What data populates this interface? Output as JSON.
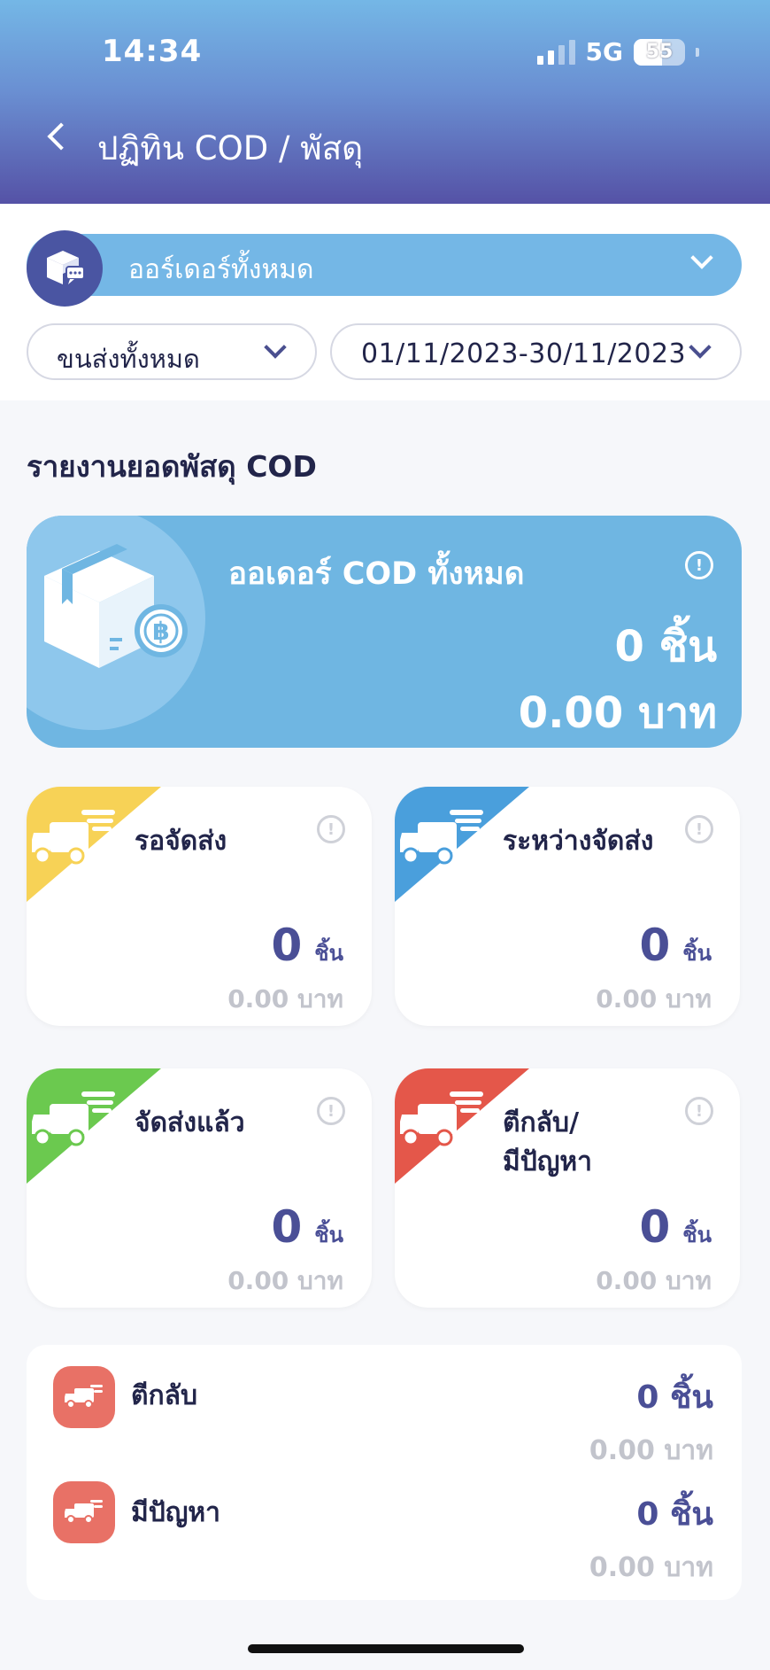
{
  "status_bar": {
    "time": "14:34",
    "network": "5G",
    "battery": "55"
  },
  "header": {
    "title": "ปฏิทิน COD / พัสดุ"
  },
  "filters": {
    "order_select": "ออร์เดอร์ทั้งหมด",
    "carrier": "ขนส่งทั้งหมด",
    "date_range": "01/11/2023-30/11/2023"
  },
  "section_title": "รายงานยอดพัสดุ COD",
  "summary": {
    "title": "ออเดอร์ COD ทั้งหมด",
    "count": "0  ชิ้น",
    "amount": "0.00  บาท"
  },
  "cards": {
    "waiting": {
      "title": "รอจัดส่ง",
      "count": "0",
      "unit": "ชิ้น",
      "amount": "0.00 บาท",
      "color": "#f7d256"
    },
    "shipping": {
      "title": "ระหว่างจัดส่ง",
      "count": "0",
      "unit": "ชิ้น",
      "amount": "0.00 บาท",
      "color": "#4a9fdc"
    },
    "delivered": {
      "title": "จัดส่งแล้ว",
      "count": "0",
      "unit": "ชิ้น",
      "amount": "0.00 บาท",
      "color": "#6bc94f"
    },
    "returned": {
      "title_line1": "ตีกลับ/",
      "title_line2": "มีปัญหา",
      "count": "0",
      "unit": "ชิ้น",
      "amount": "0.00 บาท",
      "color": "#e4574a"
    }
  },
  "breakdown": [
    {
      "label": "ตีกลับ",
      "count": "0 ชิ้น",
      "amount": "0.00 บาท"
    },
    {
      "label": "มีปัญหา",
      "count": "0 ชิ้น",
      "amount": "0.00 บาท"
    }
  ],
  "icons": {
    "back": "chevron-left-icon",
    "order_badge": "parcel-chat-icon",
    "dropdown": "chevron-down-icon",
    "info": "info-icon",
    "summary": "parcel-baht-icon",
    "truck": "truck-icon"
  }
}
